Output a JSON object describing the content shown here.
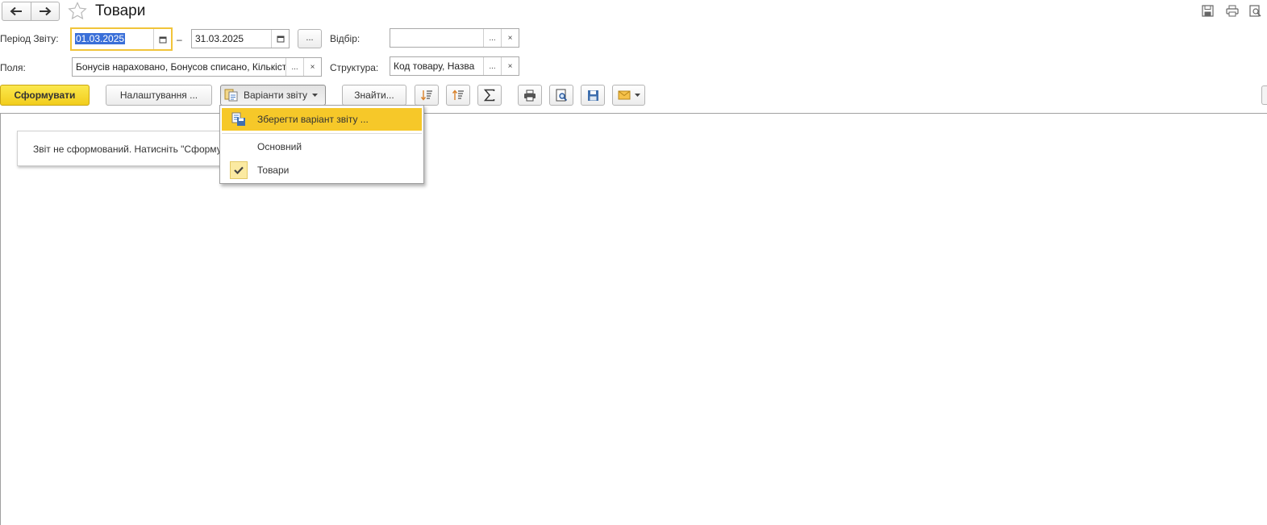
{
  "window": {
    "title": "Товари"
  },
  "report_period": {
    "label": "Період Звіту:",
    "start": "01.03.2025",
    "dash": "–",
    "end": "31.03.2025",
    "more_label": "..."
  },
  "filter": {
    "label": "Відбір:",
    "value": ""
  },
  "fields": {
    "label": "Поля:",
    "value": "Бонусів нараховано, Бонусов списано, Кількість"
  },
  "structure": {
    "label": "Структура:",
    "value": "Код товару, Назва"
  },
  "toolbar": {
    "generate_label": "Сформувати",
    "settings_label": "Налаштування ...",
    "variants_label": "Варіанти звіту",
    "find_label": "Знайти..."
  },
  "field_buttons": {
    "choose": "...",
    "clear": "×"
  },
  "variants_menu": {
    "save_label": "Зберегти варіант звіту ...",
    "items": [
      {
        "label": "Основний",
        "checked": false
      },
      {
        "label": "Товари",
        "checked": true
      }
    ]
  },
  "notice": {
    "text": "Звіт не сформований. Натисніть \"Сформувати\""
  },
  "colors": {
    "accent_yellow": "#f6c829",
    "primary_button": "#f2cd1c",
    "focus_border": "#f1c43a",
    "selection": "#3a6fd8"
  },
  "icons": {
    "back": "arrow-left-icon",
    "forward": "arrow-right-icon",
    "favorite": "star-icon",
    "save": "floppy-icon",
    "print": "printer-icon",
    "preview": "print-preview-icon",
    "calendar": "calendar-icon",
    "sort_desc": "sort-descending-icon",
    "sort_asc": "sort-ascending-icon",
    "sum": "sigma-icon",
    "email": "envelope-icon",
    "check": "check-icon",
    "report_variant": "report-variant-icon"
  }
}
